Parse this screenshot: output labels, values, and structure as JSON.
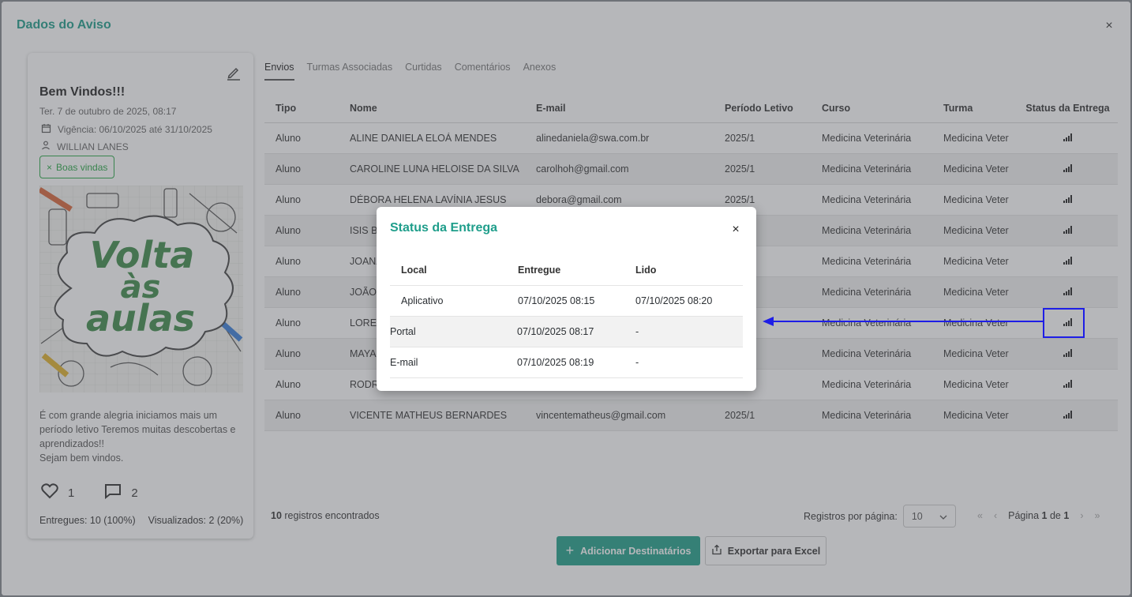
{
  "dialog": {
    "title": "Dados do Aviso",
    "close_label": "×"
  },
  "card": {
    "title": "Bem Vindos!!!",
    "date": "Ter. 7 de outubro de 2025, 08:17",
    "validity": "Vigência: 06/10/2025 até 31/10/2025",
    "author": "WILLIAN LANES",
    "tag": "Boas vindas",
    "image_text": [
      "Volta",
      "às",
      "aulas"
    ],
    "body": "É com grande alegria iniciamos mais um período letivo Teremos muitas descobertas e aprendizados!!\nSejam bem vindos.",
    "likes": "1",
    "comments": "2",
    "delivered": "Entregues: 10 (100%)",
    "viewed": "Visualizados: 2 (20%)"
  },
  "tabs": [
    "Envios",
    "Turmas Associadas",
    "Curtidas",
    "Comentários",
    "Anexos"
  ],
  "table": {
    "headers": [
      "Tipo",
      "Nome",
      "E-mail",
      "Período Letivo",
      "Curso",
      "Turma",
      "Status da Entrega"
    ],
    "rows": [
      [
        "Aluno",
        "ALINE DANIELA ELOÁ MENDES",
        "alinedaniela@swa.com.br",
        "2025/1",
        "Medicina Veterinária",
        "Medicina Veter"
      ],
      [
        "Aluno",
        "CAROLINE LUNA HELOISE DA SILVA",
        "carolhoh@gmail.com",
        "2025/1",
        "Medicina Veterinária",
        "Medicina Veter"
      ],
      [
        "Aluno",
        "DÉBORA HELENA LAVÍNIA JESUS",
        "debora@gmail.com",
        "2025/1",
        "Medicina Veterinária",
        "Medicina Veter"
      ],
      [
        "Aluno",
        "ISIS BI",
        "",
        "",
        "Medicina Veterinária",
        "Medicina Veter"
      ],
      [
        "Aluno",
        "JOANA",
        "",
        "",
        "Medicina Veterinária",
        "Medicina Veter"
      ],
      [
        "Aluno",
        "JOÃO",
        "",
        "",
        "Medicina Veterinária",
        "Medicina Veter"
      ],
      [
        "Aluno",
        "LOREN",
        "",
        "",
        "Medicina Veterinária",
        "Medicina Veter"
      ],
      [
        "Aluno",
        "MAYA",
        "",
        "",
        "Medicina Veterinária",
        "Medicina Veter"
      ],
      [
        "Aluno",
        "RODRI",
        "",
        "",
        "Medicina Veterinária",
        "Medicina Veter"
      ],
      [
        "Aluno",
        "VICENTE MATHEUS BERNARDES",
        "vincentematheus@gmail.com",
        "2025/1",
        "Medicina Veterinária",
        "Medicina Veter"
      ]
    ]
  },
  "footer": {
    "records_count": "10",
    "records_label": "registros encontrados",
    "per_page_label": "Registros por página:",
    "per_page_value": "10",
    "page_label": "Página",
    "page_current": "1",
    "page_of": "de",
    "page_total": "1"
  },
  "buttons": {
    "add_recipients": "Adicionar Destinatários",
    "export_excel": "Exportar para Excel"
  },
  "modal": {
    "title": "Status da Entrega",
    "close_label": "×",
    "headers": [
      "Local",
      "Entregue",
      "Lido"
    ],
    "rows": [
      [
        "Aplicativo",
        "07/10/2025 08:15",
        "07/10/2025 08:20"
      ],
      [
        "Portal",
        "07/10/2025 08:17",
        "-"
      ],
      [
        "E-mail",
        "07/10/2025 08:19",
        "-"
      ]
    ]
  },
  "colors": {
    "accent": "#1f9e8b",
    "primary_button": "#21a08a",
    "tag": "#28a745",
    "annotation": "#1e1ee6"
  }
}
